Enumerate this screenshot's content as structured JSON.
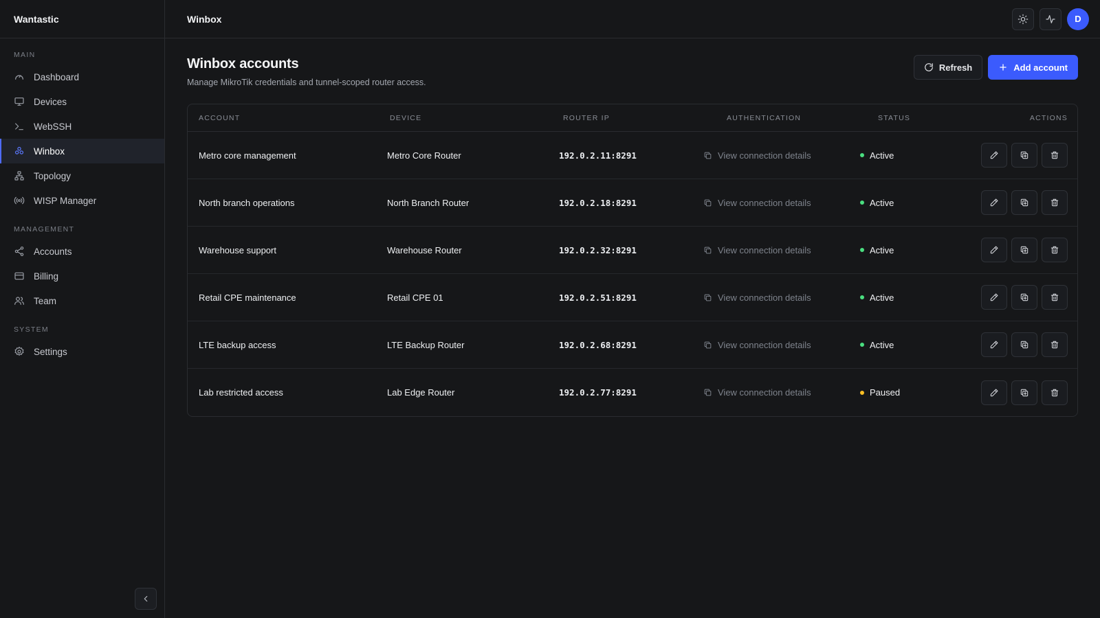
{
  "brand": "Wantastic",
  "sidebar": {
    "sections": [
      {
        "title": "MAIN",
        "items": [
          {
            "label": "Dashboard",
            "icon": "gauge-icon"
          },
          {
            "label": "Devices",
            "icon": "monitor-icon"
          },
          {
            "label": "WebSSH",
            "icon": "terminal-icon"
          },
          {
            "label": "Winbox",
            "icon": "winbox-icon",
            "active": true
          },
          {
            "label": "Topology",
            "icon": "topology-icon"
          },
          {
            "label": "WISP Manager",
            "icon": "radio-icon"
          }
        ]
      },
      {
        "title": "MANAGEMENT",
        "items": [
          {
            "label": "Accounts",
            "icon": "share-icon"
          },
          {
            "label": "Billing",
            "icon": "credit-card-icon"
          },
          {
            "label": "Team",
            "icon": "users-icon"
          }
        ]
      },
      {
        "title": "SYSTEM",
        "items": [
          {
            "label": "Settings",
            "icon": "gear-icon"
          }
        ]
      }
    ]
  },
  "topbar": {
    "title": "Winbox",
    "avatar_initial": "D"
  },
  "page": {
    "title": "Winbox accounts",
    "subtitle": "Manage MikroTik credentials and tunnel-scoped router access.",
    "refresh_label": "Refresh",
    "add_label": "Add account"
  },
  "table": {
    "headers": {
      "account": "ACCOUNT",
      "device": "DEVICE",
      "router_ip": "ROUTER IP",
      "authentication": "AUTHENTICATION",
      "status": "STATUS",
      "actions": "ACTIONS"
    },
    "rows": [
      {
        "account": "Metro core management",
        "device": "Metro Core Router",
        "ip": "192.0.2.11:8291",
        "auth": "View connection details",
        "status": "Active",
        "status_color": "#4ade80"
      },
      {
        "account": "North branch operations",
        "device": "North Branch Router",
        "ip": "192.0.2.18:8291",
        "auth": "View connection details",
        "status": "Active",
        "status_color": "#4ade80"
      },
      {
        "account": "Warehouse support",
        "device": "Warehouse Router",
        "ip": "192.0.2.32:8291",
        "auth": "View connection details",
        "status": "Active",
        "status_color": "#4ade80"
      },
      {
        "account": "Retail CPE maintenance",
        "device": "Retail CPE 01",
        "ip": "192.0.2.51:8291",
        "auth": "View connection details",
        "status": "Active",
        "status_color": "#4ade80"
      },
      {
        "account": "LTE backup access",
        "device": "LTE Backup Router",
        "ip": "192.0.2.68:8291",
        "auth": "View connection details",
        "status": "Active",
        "status_color": "#4ade80"
      },
      {
        "account": "Lab restricted access",
        "device": "Lab Edge Router",
        "ip": "192.0.2.77:8291",
        "auth": "View connection details",
        "status": "Paused",
        "status_color": "#fbbf24"
      }
    ]
  },
  "colors": {
    "accent": "#3b5bfd",
    "active": "#4ade80",
    "paused": "#fbbf24"
  }
}
